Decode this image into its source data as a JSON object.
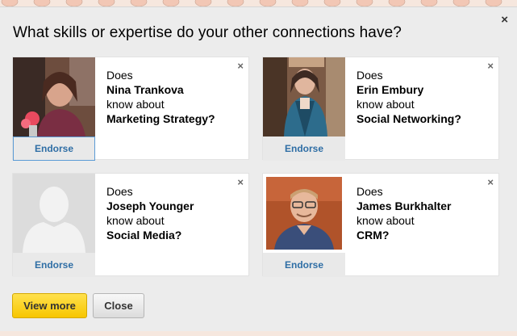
{
  "dialog": {
    "title": "What skills or expertise do your other connections have?",
    "close_label": "×"
  },
  "cards": [
    {
      "prefix": "Does",
      "name": "Nina Trankova",
      "mid": "know about",
      "skill": "Marketing Strategy?",
      "endorse_label": "Endorse",
      "dismiss_label": "×"
    },
    {
      "prefix": "Does",
      "name": "Erin Embury",
      "mid": "know about",
      "skill": "Social Networking?",
      "endorse_label": "Endorse",
      "dismiss_label": "×"
    },
    {
      "prefix": "Does",
      "name": "Joseph Younger",
      "mid": "know about",
      "skill": "Social Media?",
      "endorse_label": "Endorse",
      "dismiss_label": "×"
    },
    {
      "prefix": "Does",
      "name": "James Burkhalter",
      "mid": "know about",
      "skill": "CRM?",
      "endorse_label": "Endorse",
      "dismiss_label": "×"
    }
  ],
  "footer": {
    "view_more_label": "View more",
    "close_label": "Close"
  },
  "colors": {
    "endorse_text": "#2f6ea5",
    "primary_button": "#f7c600",
    "background": "#ececec"
  }
}
